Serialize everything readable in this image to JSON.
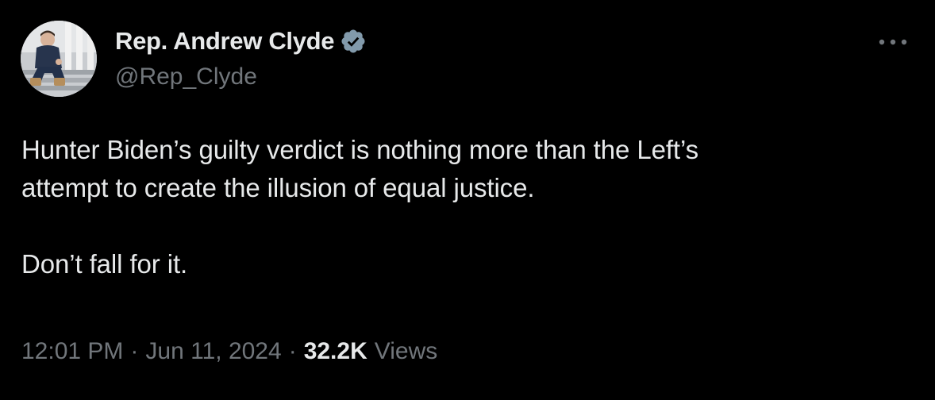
{
  "author": {
    "display_name": "Rep. Andrew Clyde",
    "handle": "@Rep_Clyde",
    "verified_color": "#829aab"
  },
  "tweet": {
    "lines": [
      "Hunter Biden’s guilty verdict is nothing more than the Left’s",
      "attempt to create the illusion of equal justice.",
      "Don’t fall for it."
    ]
  },
  "meta": {
    "time": "12:01 PM",
    "separator": "·",
    "date": "Jun 11, 2024",
    "views_count": "32.2K",
    "views_label": "Views"
  },
  "icons": {
    "more": "more-icon",
    "verified": "verified-badge-icon"
  },
  "colors": {
    "background": "#000000",
    "primary_text": "#e7e9ea",
    "secondary_text": "#71767b"
  }
}
